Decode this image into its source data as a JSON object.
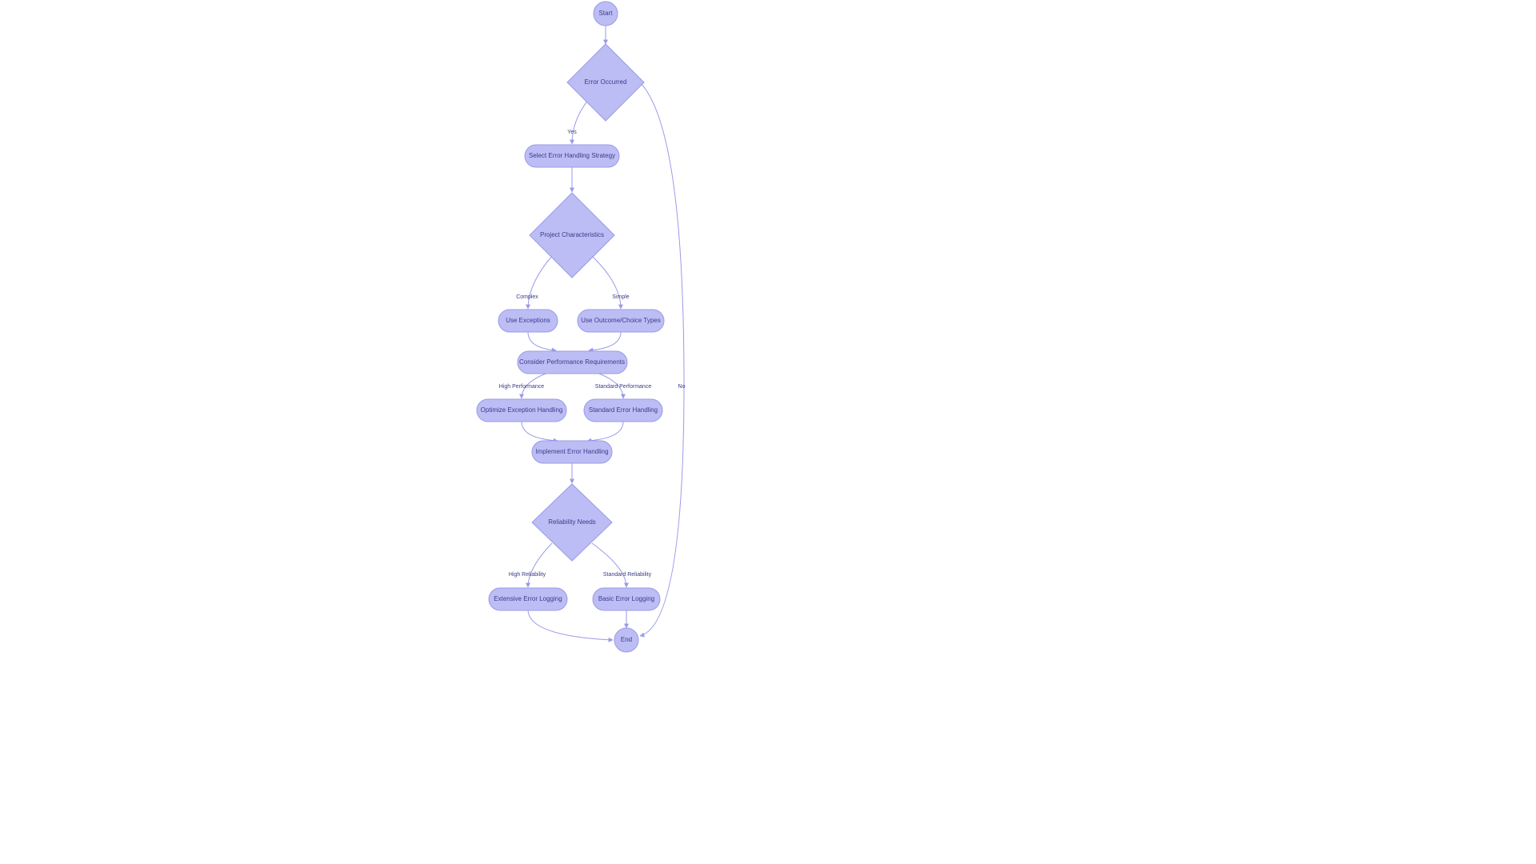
{
  "chart_data": {
    "type": "flowchart",
    "nodes": [
      {
        "id": "start",
        "shape": "circle",
        "label": "Start"
      },
      {
        "id": "error_occurred",
        "shape": "diamond",
        "label": "Error Occurred"
      },
      {
        "id": "select_strategy",
        "shape": "stadium",
        "label": "Select Error Handling Strategy"
      },
      {
        "id": "project_chars",
        "shape": "diamond",
        "label": "Project Characteristics"
      },
      {
        "id": "use_exceptions",
        "shape": "stadium",
        "label": "Use Exceptions"
      },
      {
        "id": "use_outcome",
        "shape": "stadium",
        "label": "Use Outcome/Choice Types"
      },
      {
        "id": "consider_perf",
        "shape": "stadium",
        "label": "Consider Performance Requirements"
      },
      {
        "id": "optimize_exc",
        "shape": "stadium",
        "label": "Optimize Exception Handling"
      },
      {
        "id": "standard_err",
        "shape": "stadium",
        "label": "Standard Error Handling"
      },
      {
        "id": "implement_err",
        "shape": "stadium",
        "label": "Implement Error Handling"
      },
      {
        "id": "reliability",
        "shape": "diamond",
        "label": "Reliability Needs"
      },
      {
        "id": "extensive_log",
        "shape": "stadium",
        "label": "Extensive Error Logging"
      },
      {
        "id": "basic_log",
        "shape": "stadium",
        "label": "Basic Error Logging"
      },
      {
        "id": "end",
        "shape": "circle",
        "label": "End"
      }
    ],
    "edges": [
      {
        "from": "start",
        "to": "error_occurred",
        "label": ""
      },
      {
        "from": "error_occurred",
        "to": "select_strategy",
        "label": "Yes"
      },
      {
        "from": "error_occurred",
        "to": "end",
        "label": "No"
      },
      {
        "from": "select_strategy",
        "to": "project_chars",
        "label": ""
      },
      {
        "from": "project_chars",
        "to": "use_exceptions",
        "label": "Complex"
      },
      {
        "from": "project_chars",
        "to": "use_outcome",
        "label": "Simple"
      },
      {
        "from": "use_exceptions",
        "to": "consider_perf",
        "label": ""
      },
      {
        "from": "use_outcome",
        "to": "consider_perf",
        "label": ""
      },
      {
        "from": "consider_perf",
        "to": "optimize_exc",
        "label": "High Performance"
      },
      {
        "from": "consider_perf",
        "to": "standard_err",
        "label": "Standard Performance"
      },
      {
        "from": "optimize_exc",
        "to": "implement_err",
        "label": ""
      },
      {
        "from": "standard_err",
        "to": "implement_err",
        "label": ""
      },
      {
        "from": "implement_err",
        "to": "reliability",
        "label": ""
      },
      {
        "from": "reliability",
        "to": "extensive_log",
        "label": "High Reliability"
      },
      {
        "from": "reliability",
        "to": "basic_log",
        "label": "Standard Reliability"
      },
      {
        "from": "extensive_log",
        "to": "end",
        "label": ""
      },
      {
        "from": "basic_log",
        "to": "end",
        "label": ""
      }
    ]
  },
  "nodes": {
    "start": "Start",
    "error_occurred": "Error Occurred",
    "select_strategy": "Select Error Handling Strategy",
    "project_chars": "Project Characteristics",
    "use_exceptions": "Use Exceptions",
    "use_outcome": "Use Outcome/Choice Types",
    "consider_perf": "Consider Performance Requirements",
    "optimize_exc": "Optimize Exception Handling",
    "standard_err": "Standard Error Handling",
    "implement_err": "Implement Error Handling",
    "reliability": "Reliability Needs",
    "extensive_log": "Extensive Error Logging",
    "basic_log": "Basic Error Logging",
    "end": "End"
  },
  "labels": {
    "yes": "Yes",
    "no": "No",
    "complex": "Complex",
    "simple": "Simple",
    "high_perf": "High Performance",
    "std_perf": "Standard Performance",
    "high_rel": "High Reliability",
    "std_rel": "Standard Reliability"
  }
}
